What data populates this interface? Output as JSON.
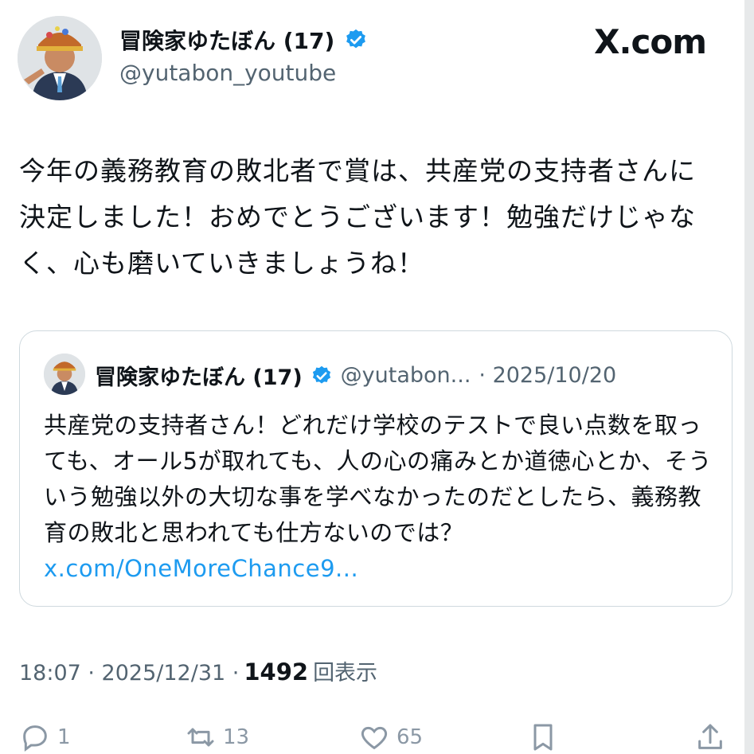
{
  "author": {
    "name": "冒険家ゆたぼん (17)",
    "handle": "@yutabon_youtube"
  },
  "site": "X.com",
  "tweet_text": "今年の義務教育の敗北者で賞は、共産党の支持者さんに決定しました！おめでとうございます！勉強だけじゃなく、心も磨いていきましょうね！",
  "quote": {
    "name": "冒険家ゆたぼん (17)",
    "handle": "@yutabon...",
    "date": "· 2025/10/20",
    "text": "共産党の支持者さん！どれだけ学校のテストで良い点数を取っても、オール5が取れても、人の心の痛みとか道徳心とか、そういう勉強以外の大切な事を学べなかったのだとしたら、義務教育の敗北と思われても仕方ないのでは？ ",
    "link": "x.com/OneMoreChance9..."
  },
  "meta": {
    "time": "18:07 · 2025/12/31 ·",
    "views": "1492",
    "views_label": "回表示"
  },
  "actions": {
    "replies": "1",
    "reposts": "13",
    "likes": "65"
  },
  "colors": {
    "verified": "#1d9bf0",
    "link": "#1d9bf0",
    "muted": "#536471"
  },
  "icons": [
    "verified-badge-icon",
    "reply-icon",
    "repost-icon",
    "like-icon",
    "bookmark-icon",
    "share-icon"
  ]
}
